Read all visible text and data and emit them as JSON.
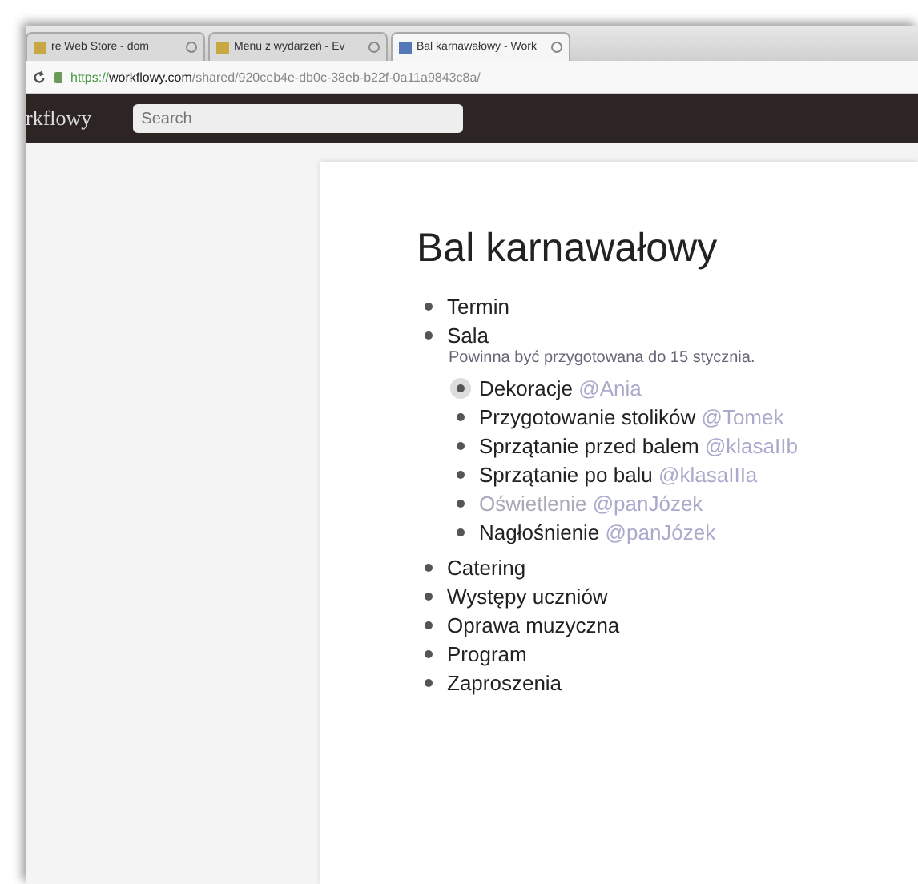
{
  "browser": {
    "tabs": [
      {
        "label": "re Web Store - dom",
        "selected": false
      },
      {
        "label": "Menu z wydarzeń - Ev",
        "selected": false
      },
      {
        "label": "Bal karnawałowy - Work",
        "selected": true
      }
    ],
    "url_scheme": "https://",
    "url_host": "workflowy.com",
    "url_path": "/shared/920ceb4e-db0c-38eb-b22f-0a11a9843c8a/"
  },
  "app": {
    "logo": "rkflowy",
    "search": {
      "placeholder": "Search"
    }
  },
  "page": {
    "title": "Bal karnawałowy",
    "items": [
      {
        "text": "Termin",
        "completed": false
      },
      {
        "text": "Sala",
        "completed": false,
        "note": "Powinna być przygotowana do 15 stycznia.",
        "children": [
          {
            "text": "Dekoracje",
            "tag": "@Ania",
            "completed": false,
            "selected": true
          },
          {
            "text": "Przygotowanie stolików",
            "tag": "@Tomek",
            "completed": false,
            "selected": false
          },
          {
            "text": "Sprzątanie przed balem",
            "tag": "@klasaIIb",
            "completed": false,
            "selected": false
          },
          {
            "text": "Sprzątanie po balu",
            "tag": "@klasaIIIa",
            "completed": false,
            "selected": false
          },
          {
            "text": "Oświetlenie",
            "tag": "@panJózek",
            "completed": true,
            "selected": false
          },
          {
            "text": "Nagłośnienie",
            "tag": "@panJózek",
            "completed": false,
            "selected": false
          }
        ]
      },
      {
        "text": "Catering",
        "completed": false
      },
      {
        "text": "Występy uczniów",
        "completed": false
      },
      {
        "text": "Oprawa muzyczna",
        "completed": false
      },
      {
        "text": "Program",
        "completed": false
      },
      {
        "text": "Zaproszenia",
        "completed": false
      }
    ]
  }
}
